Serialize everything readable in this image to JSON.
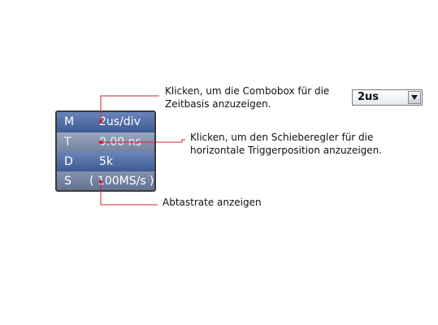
{
  "panel": {
    "rows": [
      {
        "key": "M",
        "value": "2us/div"
      },
      {
        "key": "T",
        "value": "0.00 ns"
      },
      {
        "key": "D",
        "value": "5k"
      },
      {
        "key": "S",
        "value": "( 100MS/s )"
      }
    ]
  },
  "callouts": {
    "timebase": {
      "line1": "Klicken, um die Combobox für die",
      "line2": "Zeitbasis anzuzeigen."
    },
    "trigger": {
      "line1": "Klicken, um den Schieberegler für die",
      "line2": "horizontale Triggerposition anzuzeigen."
    },
    "samplerate": {
      "line1": "Abtastrate anzeigen"
    }
  },
  "combobox": {
    "value": "2us"
  },
  "colors": {
    "callout_line": "#d0202a",
    "panel_blue": "#3e5a94",
    "panel_grey": "#73829f"
  }
}
